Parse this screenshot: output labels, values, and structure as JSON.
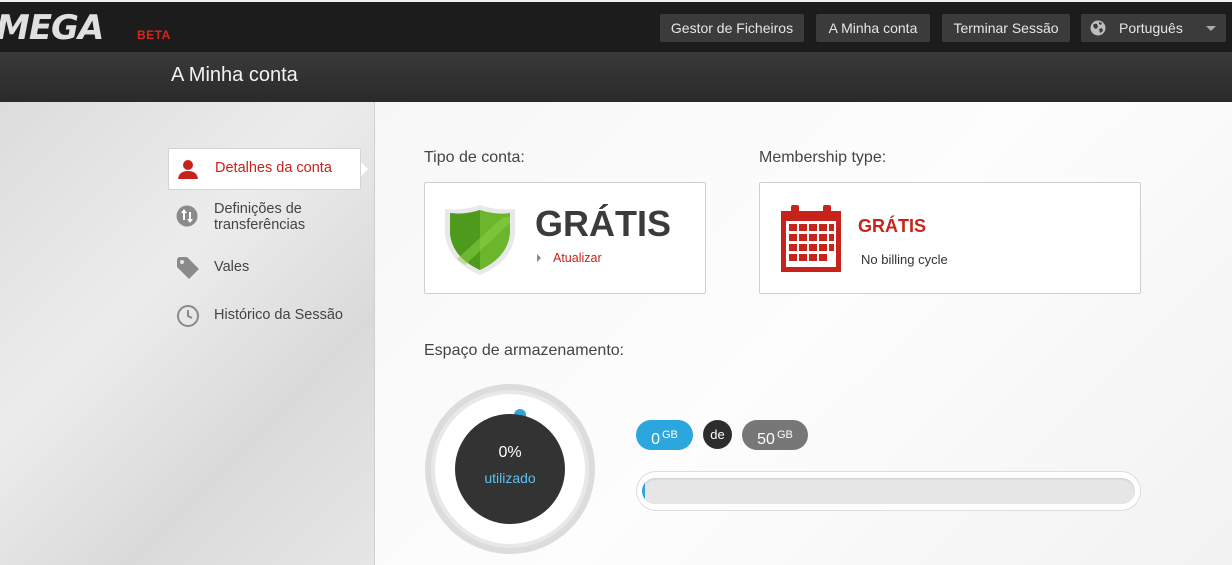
{
  "app": {
    "logo": "MEGA",
    "badge": "BETA"
  },
  "topbar": {
    "files": "Gestor de Ficheiros",
    "account": "A Minha conta",
    "logout": "Terminar Sessão",
    "language": "Português"
  },
  "page_title": "A Minha conta",
  "sidebar": {
    "items": [
      {
        "label": "Detalhes da conta",
        "icon": "user-icon",
        "active": true
      },
      {
        "label": "Definições de transferências",
        "icon": "transfer-arrows-icon",
        "active": false
      },
      {
        "label": "Vales",
        "icon": "tag-icon",
        "active": false
      },
      {
        "label": "Histórico da Sessão",
        "icon": "clock-icon",
        "active": false
      }
    ]
  },
  "account": {
    "type_label": "Tipo de conta:",
    "type_value": "GRÁTIS",
    "upgrade": "Atualizar",
    "membership_label": "Membership type:",
    "membership_value": "GRÁTIS",
    "billing": "No billing cycle"
  },
  "storage": {
    "label": "Espaço de armazenamento:",
    "percent_text": "0%",
    "used_text": "utilizado",
    "used_value": "0",
    "used_unit": "GB",
    "of": "de",
    "total_value": "50",
    "total_unit": "GB",
    "usage_fraction": 0
  },
  "colors": {
    "accent_red": "#c8231b",
    "accent_blue": "#2ba6de",
    "topbar_bg": "#1c1c1c"
  }
}
